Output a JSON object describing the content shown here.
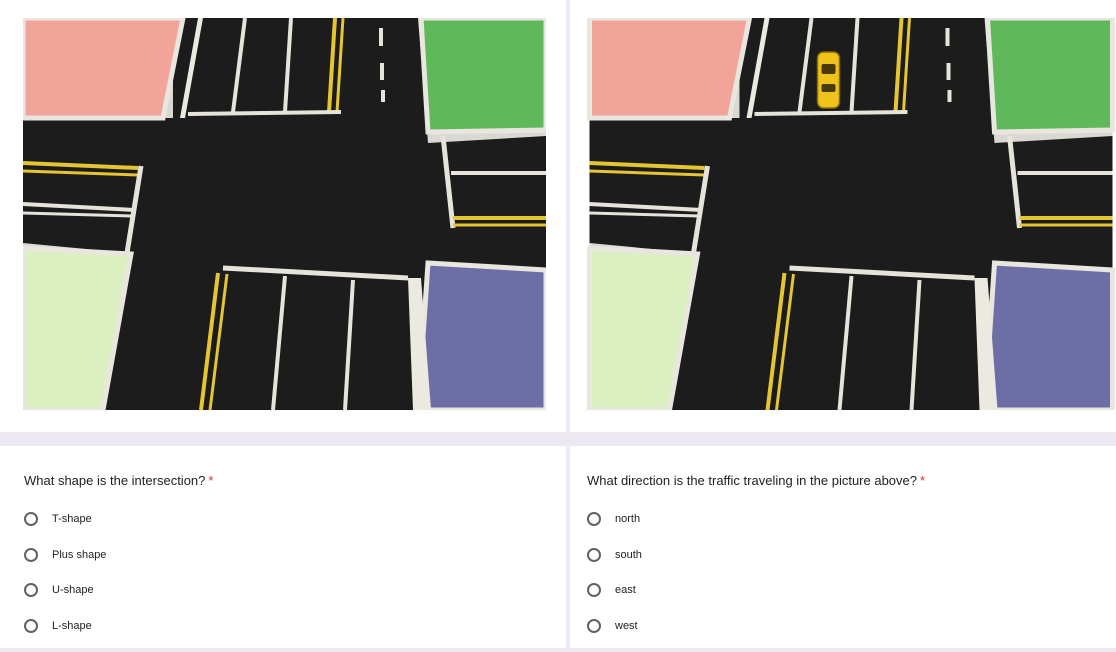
{
  "left_card": {
    "image": {
      "name": "intersection-photo-empty"
    },
    "question": "What shape is the intersection?",
    "required_mark": "*",
    "options": [
      "T-shape",
      "Plus shape",
      "U-shape",
      "L-shape"
    ]
  },
  "right_card": {
    "image": {
      "name": "intersection-photo-with-car"
    },
    "question": "What direction is the traffic traveling in the picture above?",
    "required_mark": "*",
    "options": [
      "north",
      "south",
      "east",
      "west"
    ]
  },
  "colors": {
    "page_background": "#ede9f3",
    "required": "#d93025",
    "road": "#1c1c1c",
    "lane_yellow": "#e5c532",
    "block_pink": "#f2a49a",
    "block_green": "#5fb85a",
    "block_lightgreen": "#dcefc0",
    "block_blue": "#6e6ea6",
    "car_yellow": "#f1c21b"
  }
}
